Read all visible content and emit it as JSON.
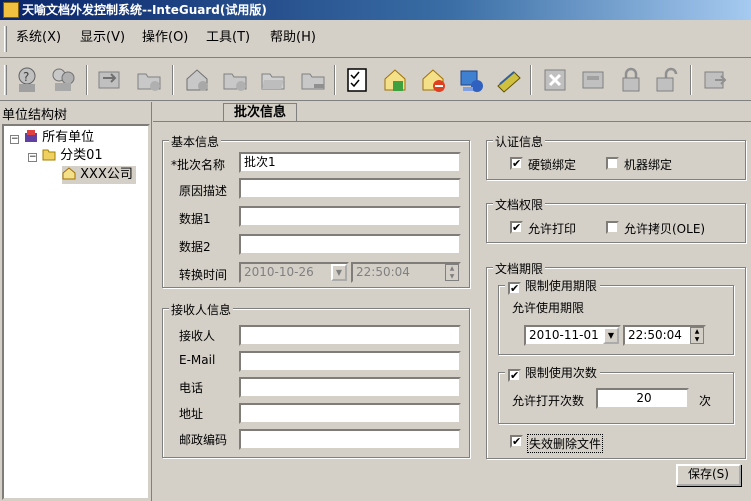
{
  "window": {
    "title": "天喻文档外发控制系统--InteGuard(试用版)"
  },
  "menu": {
    "items": [
      "系统(X)",
      "显示(V)",
      "操作(O)",
      "工具(T)",
      "帮助(H)"
    ]
  },
  "toolbar": {
    "buttons": [
      "help",
      "users",
      "swap",
      "folder-add",
      "home-add",
      "folder-add-2",
      "folder-open",
      "folder-remove",
      "checklist",
      "home-refresh",
      "home-delete",
      "network-drive",
      "books",
      "close-x",
      "drive",
      "lock",
      "unlock",
      "export"
    ]
  },
  "sidebar": {
    "title": "单位结构树",
    "tree": {
      "root": "所有单位",
      "category": "分类01",
      "company": "XXX公司"
    }
  },
  "tab": {
    "label": "批次信息"
  },
  "basic": {
    "legend": "基本信息",
    "batch_name_label": "*批次名称",
    "batch_name_value": "批次1",
    "reason_label": "原因描述",
    "reason_value": "",
    "data1_label": "数据1",
    "data1_value": "",
    "data2_label": "数据2",
    "data2_value": "",
    "convert_time_label": "转换时间",
    "convert_date": "2010-10-26",
    "convert_time": "22:50:04"
  },
  "receiver": {
    "legend": "接收人信息",
    "receiver_label": "接收人",
    "email_label": "E-Mail",
    "phone_label": "电话",
    "address_label": "地址",
    "postcode_label": "邮政编码"
  },
  "auth": {
    "legend": "认证信息",
    "hardlock_label": "硬锁绑定",
    "hardlock_checked": true,
    "machine_label": "机器绑定",
    "machine_checked": false
  },
  "perm": {
    "legend": "文档权限",
    "print_label": "允许打印",
    "print_checked": true,
    "copy_label": "允许拷贝(OLE)",
    "copy_checked": false
  },
  "period": {
    "legend": "文档期限",
    "limit_date_label": "限制使用期限",
    "limit_date_checked": true,
    "allowed_period_label": "允许使用期限",
    "date": "2010-11-01",
    "time": "22:50:04",
    "limit_count_label": "限制使用次数",
    "limit_count_checked": true,
    "open_count_label": "允许打开次数",
    "open_count": "20",
    "times_unit": "次",
    "delete_label": "失效删除文件",
    "delete_checked": true
  },
  "save_label": "保存(S)"
}
